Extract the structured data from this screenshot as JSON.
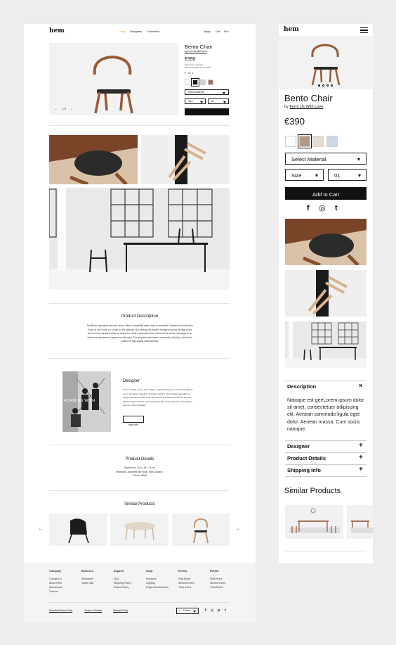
{
  "desktop": {
    "logo": "hem",
    "nav": [
      "Shop",
      "Designers",
      "Customize"
    ],
    "utility": [
      "Signup",
      "Cart",
      "EN ▾"
    ],
    "product": {
      "title": "Bento Chair",
      "byline": "by Form Us With Love",
      "price": "€390",
      "delivery_line1": "Delivered in 4-6 days",
      "delivery_line2": "Returns allowed up to 14 days",
      "select_material": "Select Material",
      "size_label": "Size",
      "size_value": "01",
      "add_to_cart": "Add to Cart",
      "pager": "1 / 4",
      "swatch_colors": [
        "#ffffff",
        "#1a1a1a",
        "#d8cfc4",
        "#a0715a"
      ]
    },
    "description": {
      "heading": "Product Description",
      "body": [
        "The Bento epitomises the Hem vision: refined, beautifully made, easy to assemble. Created by Stockholm's",
        "Form Us With Love, it's a chair for the nomadic 21st century city dweller. A single bolt joins the legs to the",
        "seat, then the backrest slides on simply for a total construction time of less than a minute, allowing it to be",
        "taken from apartment to apartment with ease. The lacquered ash frame, meanwhile, is firmly in the Nordic",
        "tradition of high-quality craftsmanship."
      ]
    },
    "designer": {
      "heading": "Designer",
      "overlay": "FORM US WITH",
      "body": [
        "Form Us With Love's John Löfgren, Jonas Pettersson and Petrus Palmér",
        "met in Småland, Sweden's furniture hotbed. Their holistic approach to",
        "design has seen FUWL work with brands like Bolon and Muuto and win",
        "2013 Designer Of The Year from ELLE Decoration Sweden. Their Bento",
        "chair is a Hem highlight."
      ],
      "more_info": "More Info"
    },
    "details": {
      "heading": "Product Details",
      "lines": [
        "Dimensions: 44.5 x 82 x 74 cm.",
        "Materials: Lacquered ash frame, fabric cushion.",
        "Colours: Black"
      ]
    },
    "similar": {
      "heading": "Similar Products",
      "prev": "←",
      "next": "→"
    },
    "footer": {
      "columns": [
        {
          "title": "Company",
          "items": [
            "Contact Us",
            "About Hem",
            "Showrooms",
            "Careers"
          ]
        },
        {
          "title": "Business",
          "items": [
            "Wholesale",
            "Trade Sale"
          ]
        },
        {
          "title": "Support",
          "items": [
            "FAQ",
            "Shipping Policy",
            "Return Policy"
          ]
        },
        {
          "title": "Shop",
          "items": [
            "Furniture",
            "Lighting",
            "Rugs & Accessories"
          ]
        },
        {
          "title": "Events",
          "items": [
            "First Event",
            "Second Event",
            "Third Event"
          ]
        },
        {
          "title": "Events",
          "items": [
            "First Event",
            "Second Event",
            "Third Event"
          ]
        }
      ],
      "links": [
        "Download Press Pack",
        "Terms of Service",
        "Privacy Policy"
      ],
      "region": "France",
      "social": [
        "f",
        "◎",
        "p",
        "t"
      ]
    }
  },
  "mobile": {
    "logo": "hem",
    "title": "Bento Chair",
    "byline_prefix": "by ",
    "byline_link": "Form Us With Love",
    "price": "€390",
    "swatch_colors": [
      "#ffffff",
      "#b49a86",
      "#e4dcd2",
      "#c9d8e6"
    ],
    "select_material": "Select Material",
    "size_label": "Size",
    "size_value": "01",
    "add_to_cart": "Add to Cart",
    "social": [
      "f",
      "◎",
      "t"
    ],
    "description_heading": "Description",
    "description_body": [
      "Natoque est geeLorem ipsum dolor",
      "sit amet, consectetuer adipiscing",
      "elit. Aenean commodo ligula eget",
      "dolor. Aenean massa. Cum sociis",
      "natoque."
    ],
    "accordions": [
      "Designer",
      "Product Details",
      "Shipping Info"
    ],
    "close_symbol": "×",
    "plus_symbol": "+",
    "similar_heading": "Similar Products"
  }
}
